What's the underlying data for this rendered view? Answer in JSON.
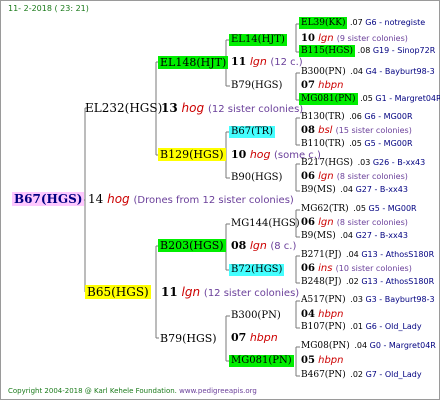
{
  "header": {
    "date": "11-  2-2018 ( 23: 21)"
  },
  "footer": {
    "copyright": "Copyright 2004-2018 @ Karl Kehele Foundation.",
    "website": "www.pedigreeapis.org"
  },
  "colors": {
    "pink": "#ffc8ff",
    "green": "#00ee00",
    "yellow": "#ffff00",
    "cyan": "#44ffff",
    "red": "#cc0000",
    "purple": "#6a3f9a",
    "navy": "#000080",
    "lines": "#7a7a7a"
  },
  "root": {
    "name": "B67(HGS)",
    "gen": "14",
    "code": "hog",
    "note": "(Drones from 12 sister colonies)"
  },
  "sire": {
    "name": "EL232(HGS)",
    "gen": "13",
    "code": "hog",
    "note": "(12 sister colonies)",
    "a": {
      "name": "EL148(HJT)",
      "gen": "11",
      "code": "lgn",
      "note": "(12 c.)",
      "a": {
        "name": "EL14(HJT)",
        "gen": "10",
        "code": "lgn",
        "note": "(9 sister colonies)",
        "a": {
          "name": "EL39(KK)",
          "num": ".07",
          "info": "G6 - notregiste"
        },
        "b": {
          "name": "B115(HGS)",
          "num": ".08",
          "info": "G19 - Sinop72R"
        }
      },
      "b": {
        "name": "B79(HGS)",
        "gen": "07",
        "code": "hbpn",
        "a": {
          "name": "B300(PN)",
          "num": ".04",
          "info": "G4 - Bayburt98-3"
        },
        "b": {
          "name": "MG081(PN)",
          "num": ".05",
          "info": "G1 - Margret04R"
        }
      }
    },
    "b": {
      "name": "B129(HGS)",
      "gen": "10",
      "code": "hog",
      "note": "(some c.)",
      "a": {
        "name": "B67(TR)",
        "gen": "08",
        "code": "bsl",
        "note": "(15 sister colonies)",
        "a": {
          "name": "B130(TR)",
          "num": ".06",
          "info": "G6 - MG00R"
        },
        "b": {
          "name": "B110(TR)",
          "num": ".05",
          "info": "G5 - MG00R"
        }
      },
      "b": {
        "name": "B90(HGS)",
        "gen": "06",
        "code": "lgn",
        "note": "(8 sister colonies)",
        "a": {
          "name": "B217(HGS)",
          "num": ".03",
          "info": "G26 - B-xx43"
        },
        "b": {
          "name": "B9(MS)",
          "num": ".04",
          "info": "G27 - B-xx43"
        }
      }
    }
  },
  "dam": {
    "name": "B65(HGS)",
    "gen": "11",
    "code": "lgn",
    "note": "(12 sister colonies)",
    "a": {
      "name": "B203(HGS)",
      "gen": "08",
      "code": "lgn",
      "note": "(8 c.)",
      "a": {
        "name": "MG144(HGS)",
        "gen": "06",
        "code": "lgn",
        "note": "(8 sister colonies)",
        "a": {
          "name": "MG62(TR)",
          "num": ".05",
          "info": "G5 - MG00R"
        },
        "b": {
          "name": "B9(MS)",
          "num": ".04",
          "info": "G27 - B-xx43"
        }
      },
      "b": {
        "name": "B72(HGS)",
        "gen": "06",
        "code": "ins",
        "note": "(10 sister colonies)",
        "a": {
          "name": "B271(PJ)",
          "num": ".04",
          "info": "G13 - AthosS180R"
        },
        "b": {
          "name": "B248(PJ)",
          "num": ".02",
          "info": "G13 - AthosS180R"
        }
      }
    },
    "b": {
      "name": "B79(HGS)",
      "gen": "07",
      "code": "hbpn",
      "a": {
        "name": "B300(PN)",
        "gen": "04",
        "code": "hbpn",
        "a": {
          "name": "A517(PN)",
          "num": ".03",
          "info": "G3 - Bayburt98-3"
        },
        "b": {
          "name": "B107(PN)",
          "num": ".01",
          "info": "G6 - Old_Lady"
        }
      },
      "b": {
        "name": "MG081(PN)",
        "gen": "05",
        "code": "hbpn",
        "a": {
          "name": "MG08(PN)",
          "num": ".04",
          "info": "G0 - Margret04R"
        },
        "b": {
          "name": "B467(PN)",
          "num": ".02",
          "info": "G7 - Old_Lady"
        }
      }
    }
  }
}
